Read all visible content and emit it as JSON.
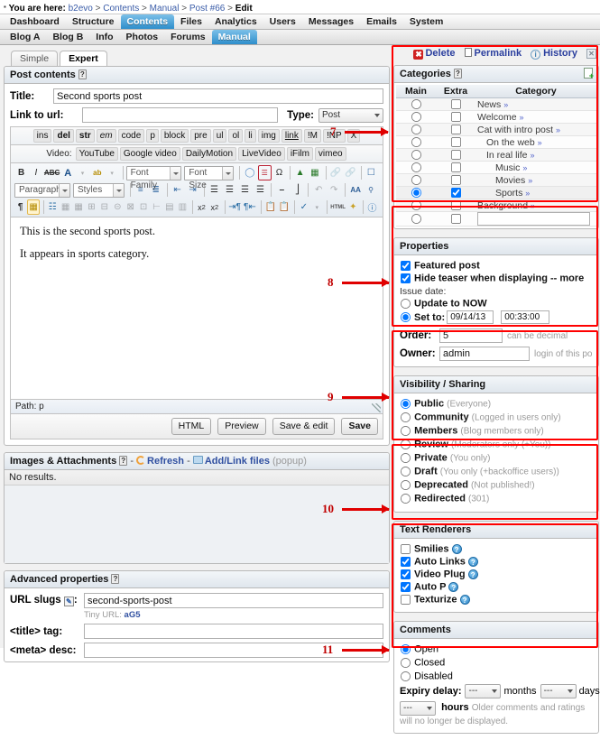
{
  "breadcrumb": {
    "label": "You are here:",
    "items": [
      "b2evo",
      "Contents",
      "Manual",
      "Post #66"
    ],
    "current": "Edit",
    "separator": ">"
  },
  "mainmenu": {
    "items": [
      "Dashboard",
      "Structure",
      "Contents",
      "Files",
      "Analytics",
      "Users",
      "Messages",
      "Emails",
      "System"
    ],
    "active": "Contents"
  },
  "submenu": {
    "items": [
      "Blog A",
      "Blog B",
      "Info",
      "Photos",
      "Forums",
      "Manual"
    ],
    "active": "Manual"
  },
  "actions": {
    "delete": "Delete",
    "permalink": "Permalink",
    "history": "History",
    "close": "⌧"
  },
  "tabs": {
    "simple": "Simple",
    "expert": "Expert",
    "active": "Expert"
  },
  "post_contents": {
    "title": "Post contents",
    "help": "?",
    "title_label": "Title:",
    "title_value": "Second sports post",
    "link_label": "Link to url:",
    "link_value": "",
    "type_label": "Type:",
    "type_value": "Post"
  },
  "quicktags": {
    "tags": [
      "ins",
      "del",
      "str",
      "em",
      "code",
      "p",
      "block",
      "pre",
      "ul",
      "ol",
      "li",
      "img",
      "link",
      "!M",
      "!NP",
      "X"
    ],
    "video_label": "Video:",
    "video_tags": [
      "YouTube",
      "Google video",
      "DailyMotion",
      "LiveVideo",
      "iFilm",
      "vimeo"
    ]
  },
  "editor": {
    "font_family": "Font Family",
    "font_size": "Font Size",
    "paragraph": "Paragraph",
    "styles": "Styles",
    "content": [
      "This is the second sports post.",
      "It appears in sports category."
    ],
    "statusbar": "Path: p",
    "buttons": [
      "HTML",
      "Preview",
      "Save & edit",
      "Save"
    ]
  },
  "images": {
    "title": "Images & Attachments",
    "help": "?",
    "refresh": "Refresh",
    "addlink": "Add/Link files",
    "popup": "(popup)",
    "noresults": "No results."
  },
  "advanced": {
    "title": "Advanced properties",
    "help": "?",
    "slug_label": "URL slugs",
    "slug_value": "second-sports-post",
    "tiny_label": "Tiny URL:",
    "tiny_value": "aG5",
    "title_tag_label": "<title> tag:",
    "title_tag_value": "",
    "meta_desc_label": "<meta> desc:",
    "meta_desc_value": ""
  },
  "categories": {
    "title": "Categories",
    "help": "?",
    "headers": [
      "Main",
      "Extra",
      "Category"
    ],
    "rows": [
      {
        "name": "News",
        "indent": 0,
        "main": false,
        "extra": false
      },
      {
        "name": "Welcome",
        "indent": 0,
        "main": false,
        "extra": false
      },
      {
        "name": "Cat with intro post",
        "indent": 0,
        "main": false,
        "extra": false
      },
      {
        "name": "On the web",
        "indent": 1,
        "main": false,
        "extra": false
      },
      {
        "name": "In real life",
        "indent": 1,
        "main": false,
        "extra": false
      },
      {
        "name": "Music",
        "indent": 2,
        "main": false,
        "extra": false
      },
      {
        "name": "Movies",
        "indent": 2,
        "main": false,
        "extra": false
      },
      {
        "name": "Sports",
        "indent": 2,
        "main": true,
        "extra": true
      },
      {
        "name": "Background",
        "indent": 0,
        "main": false,
        "extra": false
      }
    ],
    "new_value": "",
    "chevron": "»"
  },
  "properties": {
    "title": "Properties",
    "featured_label": "Featured post",
    "featured_checked": true,
    "hide_teaser_label": "Hide teaser when displaying -- more",
    "hide_teaser_checked": true,
    "issue_date_label": "Issue date:",
    "update_now_label": "Update to NOW",
    "set_to_label": "Set to:",
    "date_value": "09/14/13",
    "time_value": "00:33:00",
    "order_label": "Order:",
    "order_value": "5",
    "order_note": "can be decimal",
    "owner_label": "Owner:",
    "owner_value": "admin",
    "owner_note": "login of this po"
  },
  "visibility": {
    "title": "Visibility / Sharing",
    "selected": "Public",
    "options": [
      {
        "label": "Public",
        "desc": "(Everyone)"
      },
      {
        "label": "Community",
        "desc": "(Logged in users only)"
      },
      {
        "label": "Members",
        "desc": "(Blog members only)"
      },
      {
        "label": "Review",
        "desc": "(Moderators only (+You))"
      },
      {
        "label": "Private",
        "desc": "(You only)"
      },
      {
        "label": "Draft",
        "desc": "(You only (+backoffice users))"
      },
      {
        "label": "Deprecated",
        "desc": "(Not published!)"
      },
      {
        "label": "Redirected",
        "desc": "(301)"
      }
    ]
  },
  "renderers": {
    "title": "Text Renderers",
    "options": [
      {
        "label": "Smilies",
        "checked": false
      },
      {
        "label": "Auto Links",
        "checked": true
      },
      {
        "label": "Video Plug",
        "checked": true
      },
      {
        "label": "Auto P",
        "checked": true
      },
      {
        "label": "Texturize",
        "checked": false
      }
    ]
  },
  "comments": {
    "title": "Comments",
    "selected": "Open",
    "options": [
      "Open",
      "Closed",
      "Disabled"
    ],
    "expiry_label": "Expiry delay:",
    "months_value": "---",
    "months_unit": "months",
    "days_value": "---",
    "days_unit": "days",
    "hours_value": "---",
    "hours_unit": "hours",
    "expiry_note": "Older comments and ratings will no longer be displayed."
  },
  "annotations": [
    {
      "num": "7"
    },
    {
      "num": "8"
    },
    {
      "num": "9"
    },
    {
      "num": "10"
    },
    {
      "num": "11"
    }
  ],
  "colors": {
    "accent": "#2e8ecb",
    "link": "#2b3f9e",
    "annotation": "#e00000",
    "danger": "#cf2222"
  }
}
